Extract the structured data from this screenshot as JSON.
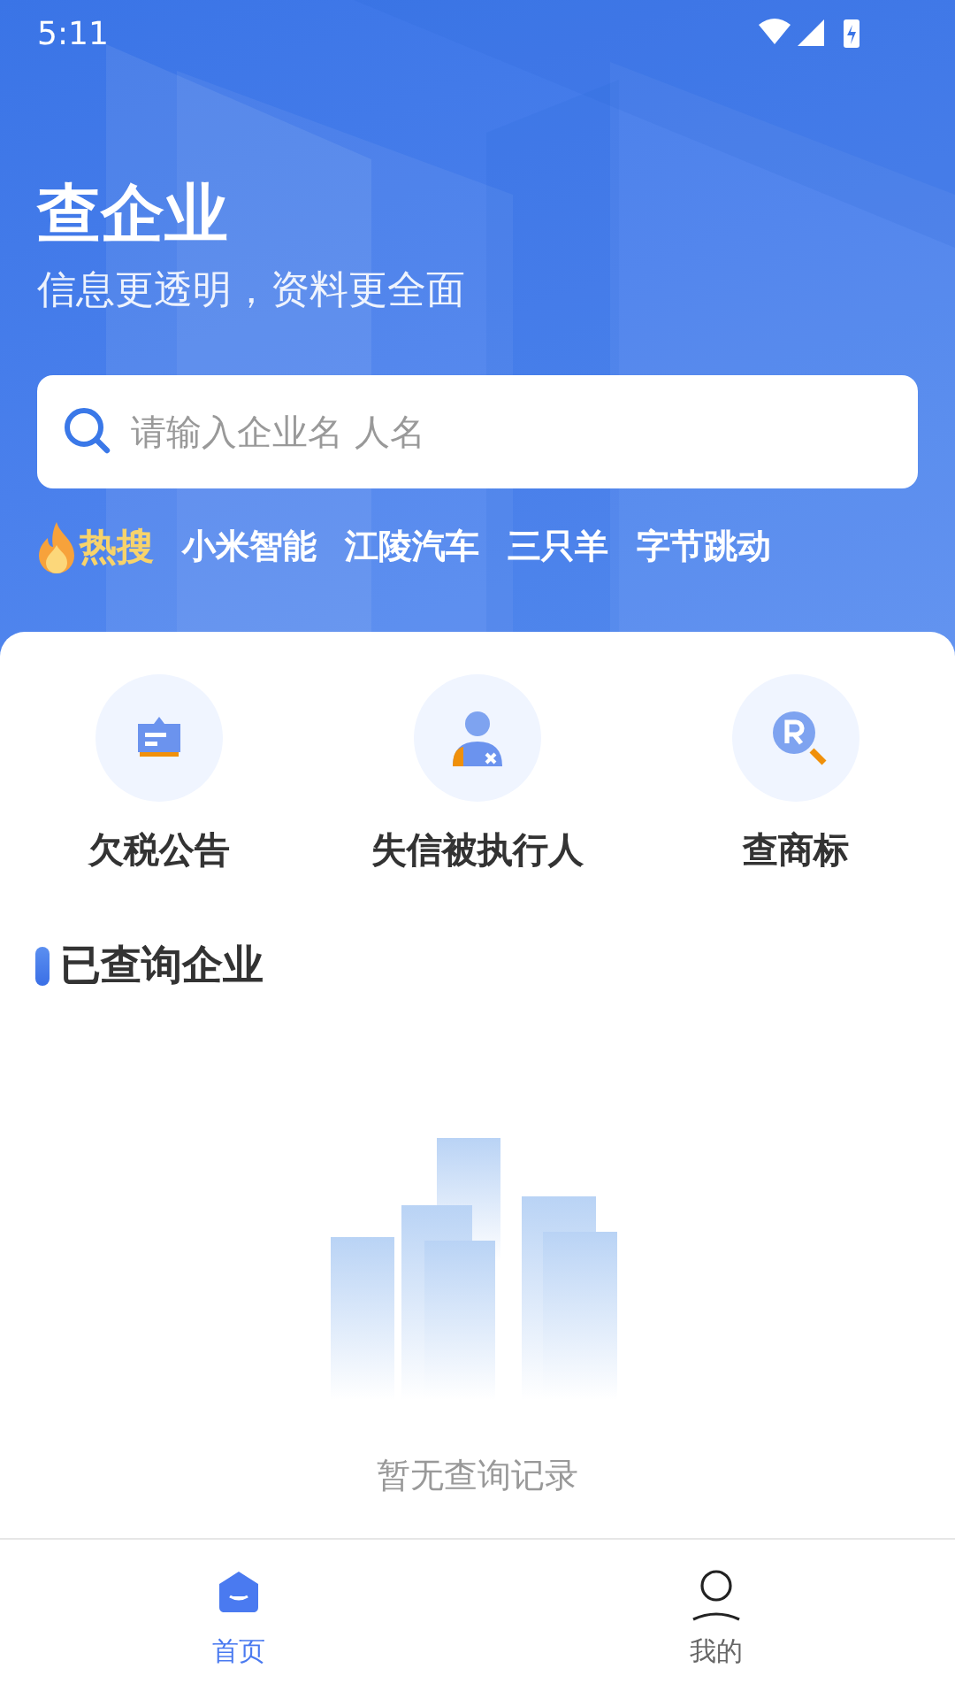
{
  "status_bar": {
    "time": "5:11"
  },
  "header": {
    "title": "查企业",
    "subtitle": "信息更透明，资料更全面"
  },
  "search": {
    "placeholder": "请输入企业名 人名"
  },
  "hot_search": {
    "label": "热搜",
    "terms": [
      "小米智能",
      "江陵汽车",
      "三只羊",
      "字节跳动"
    ]
  },
  "quick_actions": [
    {
      "kind": "tax",
      "label": "欠税公告"
    },
    {
      "kind": "debtor",
      "label": "失信被执行人"
    },
    {
      "kind": "trademark",
      "label": "查商标"
    }
  ],
  "history": {
    "title": "已查询企业",
    "empty_text": "暂无查询记录"
  },
  "bottom_nav": [
    {
      "kind": "home",
      "label": "首页",
      "selected": true
    },
    {
      "kind": "profile",
      "label": "我的",
      "selected": false
    }
  ]
}
